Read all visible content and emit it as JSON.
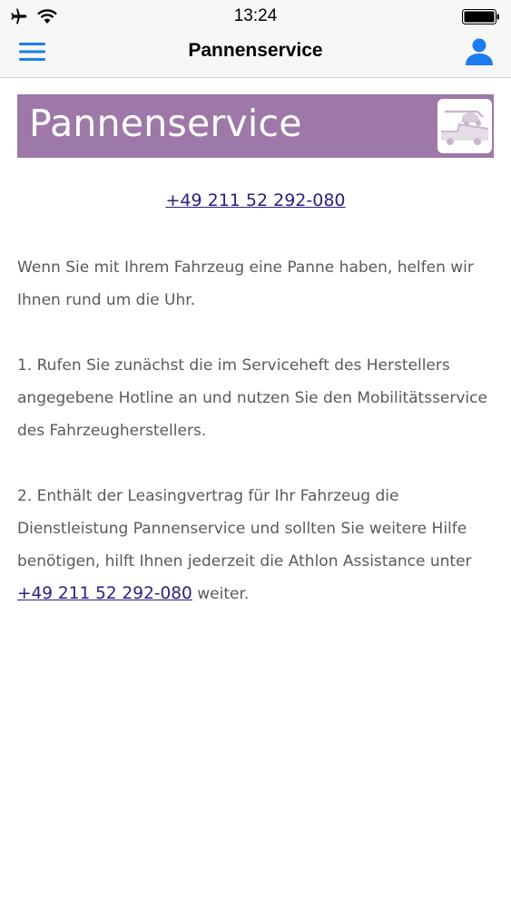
{
  "status_bar": {
    "time": "13:24",
    "icons": [
      "airplane-icon",
      "wifi-icon",
      "battery-icon"
    ]
  },
  "nav": {
    "title": "Pannenservice",
    "left_icon": "hamburger-menu-icon",
    "right_icon": "user-icon",
    "accent_color": "#1a7cf0"
  },
  "banner": {
    "title": "Pannenservice",
    "icon": "tow-truck-icon",
    "background_color": "#9e78a8"
  },
  "contact": {
    "phone": "+49 211 52 292-080"
  },
  "paragraphs": {
    "intro": "Wenn Sie mit Ihrem Fahrzeug eine Panne haben, helfen wir Ihnen rund um die Uhr.",
    "step1": "1. Rufen Sie zunächst die im Serviceheft des Herstellers angegebene Hotline an und nutzen Sie den Mobilitätsservice des Fahrzeugherstellers.",
    "step2_before": "2. Enthält der Leasingvertrag für Ihr Fahrzeug die Dienstleistung Pannenservice und sollten Sie weitere Hilfe benötigen, hilft Ihnen jederzeit die Athlon Assistance unter ",
    "step2_phone": "+49 211 52 292-080",
    "step2_after": " weiter."
  },
  "colors": {
    "link": "#2c207f",
    "body_text": "#5a5a5a"
  }
}
